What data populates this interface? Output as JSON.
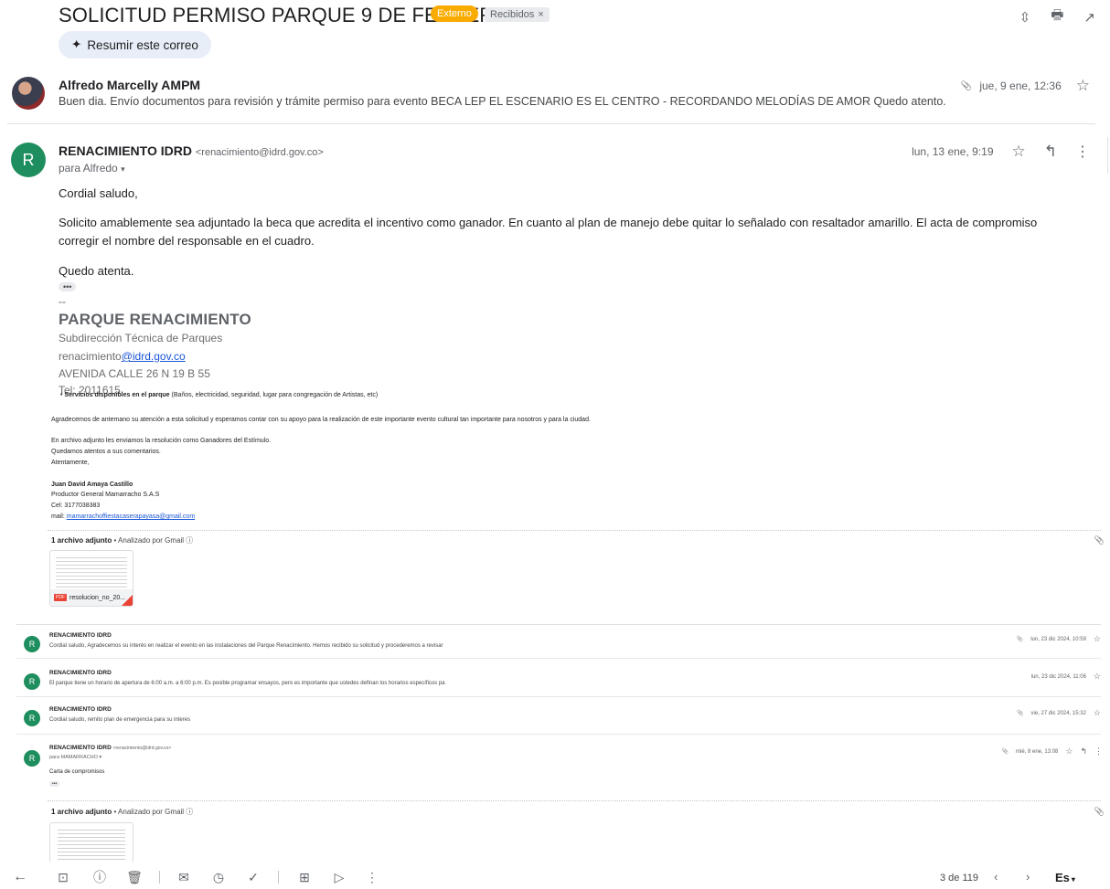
{
  "header": {
    "subject": "SOLICITUD PERMISO PARQUE 9 DE FEBRERO",
    "badge_externo": "Externo",
    "badge_recibidos": "Recibidos",
    "badge_close": "×",
    "summarize_label": "Resumir este correo"
  },
  "messages": [
    {
      "sender": "Alfredo Marcelly AMPM",
      "date": "jue, 9 ene, 12:36",
      "snippet": "Buen dia. Envío documentos para revisión y trámite permiso para evento BECA LEP EL ESCENARIO ES EL CENTRO - RECORDANDO MELODÍAS DE AMOR Quedo atento."
    },
    {
      "avatar_letter": "R",
      "sender": "RENACIMIENTO IDRD",
      "email": "<renacimiento@idrd.gov.co>",
      "to": "para Alfredo",
      "date": "lun, 13 ene, 9:19",
      "greeting": "Cordial saludo,",
      "paragraph": "Solicito amablemente sea adjuntado la beca que acredita el incentivo como ganador. En cuanto al plan de manejo debe quitar lo señalado con resaltador amarillo. El acta de compromiso corregir el nombre del responsable en el cuadro.",
      "closing": "Quedo atenta.",
      "dots": "•••",
      "sig_dash": "--",
      "sig_title": "PARQUE RENACIMIENTO",
      "sig_sub": "Subdirección Técnica de Parques",
      "sig_mail_user": "renacimiento",
      "sig_mail_domain": "@idrd.gov.co",
      "sig_addr": "AVENIDA CALLE 26 N 19 B 55",
      "sig_tel": "Tel: 2011615"
    }
  ],
  "quoted": {
    "bullet_bold": "Servicios disponibles en el parque",
    "bullet_rest": " (Baños, electricidad, seguridad, lugar para congregación de Artistas, etc)",
    "agradecemos": "Agradecemos de antemano su atención a esta solicitud y esperamos contar con su apoyo para la realización de este importante evento cultural tan importante para nosotros y para la ciudad.",
    "adjunto": "En archivo adjunto les enviamos la resolución como Ganadores del Estímulo.",
    "quedamos": "Quedamos atentos a sus comentarios.",
    "atentamente": "Atentamente,",
    "name": "Juan David Amaya Castillo",
    "role": "Productor General Mamarracho S.A.S",
    "cel": "Cel: 3177038383",
    "mail_label": "mail: ",
    "mail": "mamarrachoffiestacaserapayasa@gmail.com"
  },
  "attachment1": {
    "count_label": "1 archivo adjunto",
    "scanned": " • Analizado por Gmail ⓘ",
    "file": "resolucion_no_20...",
    "pdf": "PDF"
  },
  "rows": [
    {
      "avatar_letter": "R",
      "sender": "RENACIMIENTO IDRD",
      "snippet": "Cordial saludo, Agradecemos su interés en realizar el evento en las instalaciones del Parque Renacimiento. Hemos recibido su solicitud y procederemos a revisar",
      "date": "lun, 23 dic 2024, 10:59"
    },
    {
      "avatar_letter": "R",
      "sender": "RENACIMIENTO IDRD",
      "snippet": "El parque tiene un horario de apertura de 6:00 a.m. a 6:00 p.m. Es posible programar ensayos, pero es importante que ustedes definan los horarios específicos pa",
      "date": "lun, 23 dic 2024, 11:06"
    },
    {
      "avatar_letter": "R",
      "sender": "RENACIMIENTO IDRD",
      "snippet": "Cordial saludo, remito plan de emergencia para su interes",
      "date": "vie, 27 dic 2024, 15:32"
    },
    {
      "avatar_letter": "R",
      "sender": "RENACIMIENTO IDRD",
      "email": "<renacimiento@idrd.gov.co>",
      "to": "para MAMARRACHO",
      "body": "Carta de compromisos",
      "dots": "•••",
      "date": "mié, 8 ene, 13:08"
    }
  ],
  "attachment2": {
    "count_label": "1 archivo adjunto",
    "scanned": " • Analizado por Gmail ⓘ"
  },
  "toolbar": {
    "count": "3 de 119",
    "lang": "Es"
  },
  "icons": {
    "sort": "⇳",
    "print": "🖶",
    "open": "↗",
    "sparkle": "✦",
    "star": "☆",
    "reply": "↰",
    "more": "⋮",
    "clip": "📎",
    "back": "←",
    "archive": "⊡",
    "report": "ⓘ",
    "delete": "🗑",
    "unread": "✉",
    "snooze": "◷",
    "task": "✓",
    "move": "⊞",
    "label": "▷",
    "prev": "‹",
    "next": "›",
    "caret": "▾"
  }
}
